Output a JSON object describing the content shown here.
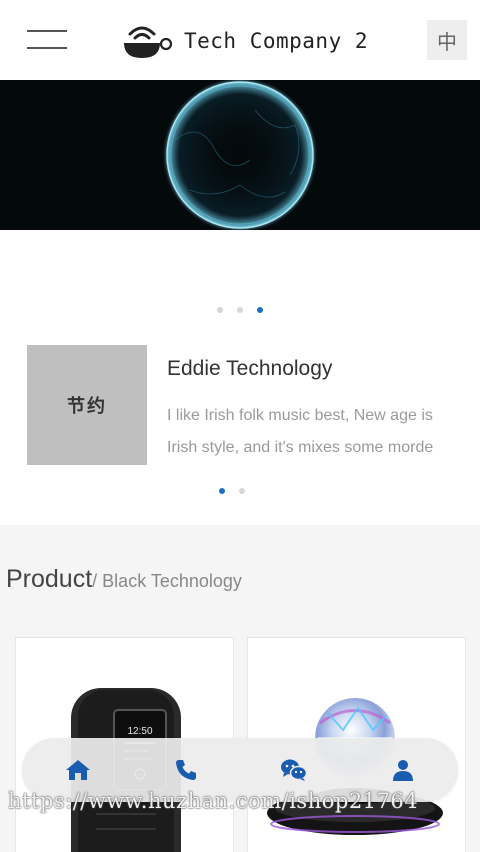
{
  "header": {
    "menu_icon": "hamburger-menu-icon",
    "logo_icon": "bowl-wifi-logo",
    "logo_text": "Tech Company 2",
    "lang_label": "中"
  },
  "banner": {
    "image": "glowing-sphere-banner",
    "slide_count": 3,
    "active_slide": 3
  },
  "news": {
    "thumb_text": "节约",
    "title": "Eddie Technology",
    "desc_line1": "I like Irish folk music best, New age is",
    "desc_line2": "Irish style, and it's mixes some morde",
    "slide_count": 2,
    "active_slide": 1
  },
  "products": {
    "title": "Product",
    "subtitle": "/ Black Technology",
    "items": [
      {
        "image": "fitness-tracker-band",
        "screen_time": "12:50"
      },
      {
        "image": "levitating-disco-ball-speaker"
      }
    ]
  },
  "footer_nav": {
    "items": [
      {
        "icon": "home-icon"
      },
      {
        "icon": "phone-icon"
      },
      {
        "icon": "wechat-icon"
      },
      {
        "icon": "user-icon"
      }
    ],
    "color": "#1a5db0"
  },
  "watermark": "https://www.huzhan.com/ishop21764",
  "colors": {
    "accent": "#1e6fc0",
    "dot_inactive": "#d6d6d6",
    "banner_bg": "#04090c",
    "product_bg": "#f5f5f5"
  }
}
